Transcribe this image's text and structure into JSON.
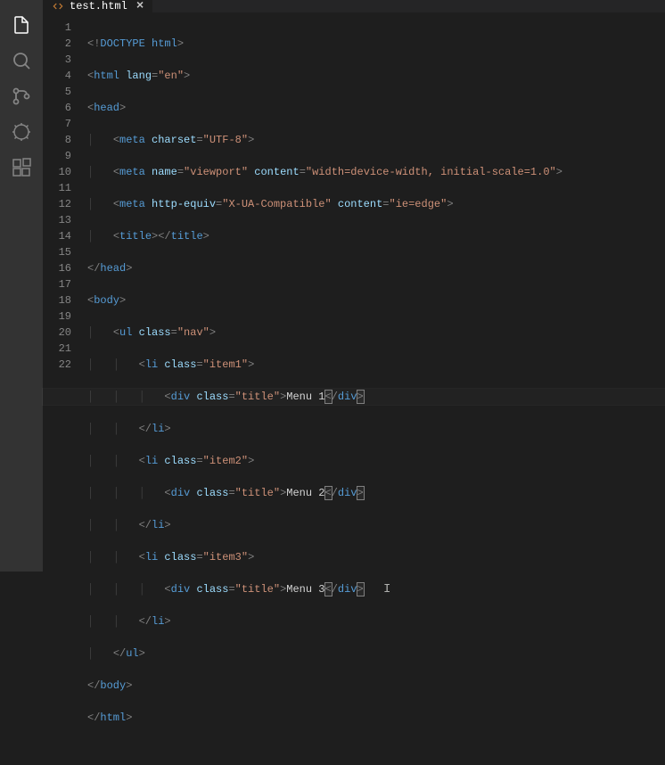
{
  "tab": {
    "filename": "test.html"
  },
  "lineNumbers": [
    "1",
    "2",
    "3",
    "4",
    "5",
    "6",
    "7",
    "8",
    "9",
    "10",
    "11",
    "12",
    "13",
    "14",
    "15",
    "16",
    "17",
    "18",
    "19",
    "20",
    "21",
    "22"
  ],
  "activeLine": 12,
  "code": {
    "doctype": "DOCTYPE html",
    "htmlTag": "html",
    "langAttr": "lang",
    "langVal": "\"en\"",
    "head": "head",
    "meta": "meta",
    "charsetAttr": "charset",
    "charsetVal": "\"UTF-8\"",
    "nameAttr": "name",
    "viewportVal": "\"viewport\"",
    "contentAttr": "content",
    "viewportContentVal": "\"width=device-width, initial-scale=1.0\"",
    "httpEquivAttr": "http-equiv",
    "httpEquivVal": "\"X-UA-Compatible\"",
    "ieEdgeVal": "\"ie=edge\"",
    "title": "title",
    "body": "body",
    "ul": "ul",
    "classAttr": "class",
    "navVal": "\"nav\"",
    "li": "li",
    "item1Val": "\"item1\"",
    "item2Val": "\"item2\"",
    "item3Val": "\"item3\"",
    "div": "div",
    "titleVal": "\"title\"",
    "menu1": "Menu 1",
    "menu2": "Menu 2",
    "menu3": "Menu 3"
  }
}
